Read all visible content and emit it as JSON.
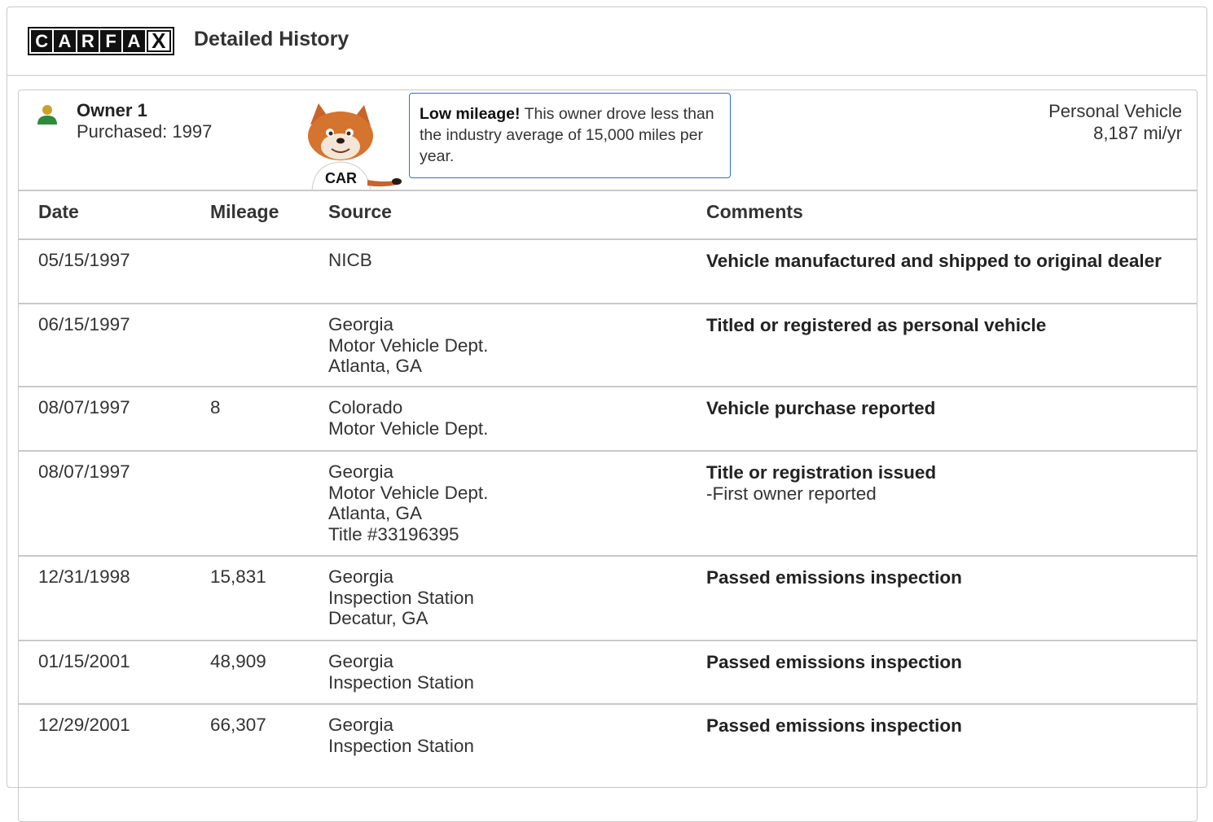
{
  "header": {
    "logo_letters": [
      "C",
      "A",
      "R",
      "F",
      "A",
      "X"
    ],
    "logo_text": "CARFAX",
    "title": "Detailed History"
  },
  "owner": {
    "name": "Owner 1",
    "purchased": "Purchased: 1997",
    "tip_bold": "Low mileage!",
    "tip_text": " This owner drove less than the industry average of 15,000 miles per year.",
    "vehicle_type": "Personal Vehicle",
    "mileage_rate": "8,187 mi/yr",
    "icon_color": "#2e8b3a",
    "icon_head_color": "#c9a227"
  },
  "table": {
    "headers": {
      "date": "Date",
      "mileage": "Mileage",
      "source": "Source",
      "comments": "Comments"
    },
    "rows": [
      {
        "date": "05/15/1997",
        "mileage": "",
        "source": [
          "NICB"
        ],
        "comment": "Vehicle manufactured and shipped to original dealer",
        "sub": ""
      },
      {
        "date": "06/15/1997",
        "mileage": "",
        "source": [
          "Georgia",
          "Motor Vehicle Dept.",
          "Atlanta, GA"
        ],
        "comment": "Titled or registered as personal vehicle",
        "sub": ""
      },
      {
        "date": "08/07/1997",
        "mileage": "8",
        "source": [
          "Colorado",
          "Motor Vehicle Dept."
        ],
        "comment": "Vehicle purchase reported",
        "sub": ""
      },
      {
        "date": "08/07/1997",
        "mileage": "",
        "source": [
          "Georgia",
          "Motor Vehicle Dept.",
          "Atlanta, GA",
          "Title #33196395"
        ],
        "comment": "Title or registration issued",
        "sub": "-First owner reported"
      },
      {
        "date": "12/31/1998",
        "mileage": "15,831",
        "source": [
          "Georgia",
          "Inspection Station",
          "Decatur, GA"
        ],
        "comment": "Passed emissions inspection",
        "sub": ""
      },
      {
        "date": "01/15/2001",
        "mileage": "48,909",
        "source": [
          "Georgia",
          "Inspection Station"
        ],
        "comment": "Passed emissions inspection",
        "sub": ""
      },
      {
        "date": "12/29/2001",
        "mileage": "66,307",
        "source": [
          "Georgia",
          "Inspection Station"
        ],
        "comment": "Passed emissions inspection",
        "sub": ""
      }
    ]
  },
  "colors": {
    "border": "#c9c9c9",
    "tip_border": "#2f6fd3"
  }
}
